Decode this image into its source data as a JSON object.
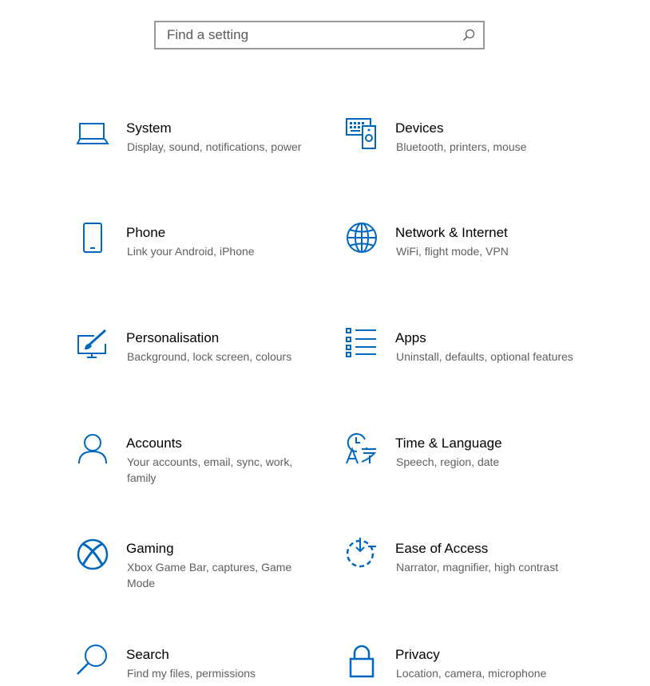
{
  "accent_color": "#0067c0",
  "search": {
    "placeholder": "Find a setting",
    "icon": "search-icon"
  },
  "tiles": [
    {
      "id": "system",
      "title": "System",
      "description": "Display, sound, notifications, power",
      "icon": "laptop-icon"
    },
    {
      "id": "devices",
      "title": "Devices",
      "description": "Bluetooth, printers, mouse",
      "icon": "keyboard-speaker-icon"
    },
    {
      "id": "phone",
      "title": "Phone",
      "description": "Link your Android, iPhone",
      "icon": "phone-icon"
    },
    {
      "id": "network",
      "title": "Network & Internet",
      "description": "WiFi, flight mode, VPN",
      "icon": "globe-icon"
    },
    {
      "id": "personalisation",
      "title": "Personalisation",
      "description": "Background, lock screen, colours",
      "icon": "paintbrush-icon"
    },
    {
      "id": "apps",
      "title": "Apps",
      "description": "Uninstall, defaults, optional features",
      "icon": "apps-list-icon"
    },
    {
      "id": "accounts",
      "title": "Accounts",
      "description": "Your accounts, email, sync, work, family",
      "icon": "person-icon"
    },
    {
      "id": "time-language",
      "title": "Time & Language",
      "description": "Speech, region, date",
      "icon": "time-language-icon"
    },
    {
      "id": "gaming",
      "title": "Gaming",
      "description": "Xbox Game Bar, captures, Game Mode",
      "icon": "xbox-icon"
    },
    {
      "id": "ease-of-access",
      "title": "Ease of Access",
      "description": "Narrator, magnifier, high contrast",
      "icon": "ease-of-access-icon"
    },
    {
      "id": "search",
      "title": "Search",
      "description": "Find my files, permissions",
      "icon": "magnifier-icon"
    },
    {
      "id": "privacy",
      "title": "Privacy",
      "description": "Location, camera, microphone",
      "icon": "padlock-icon"
    }
  ]
}
